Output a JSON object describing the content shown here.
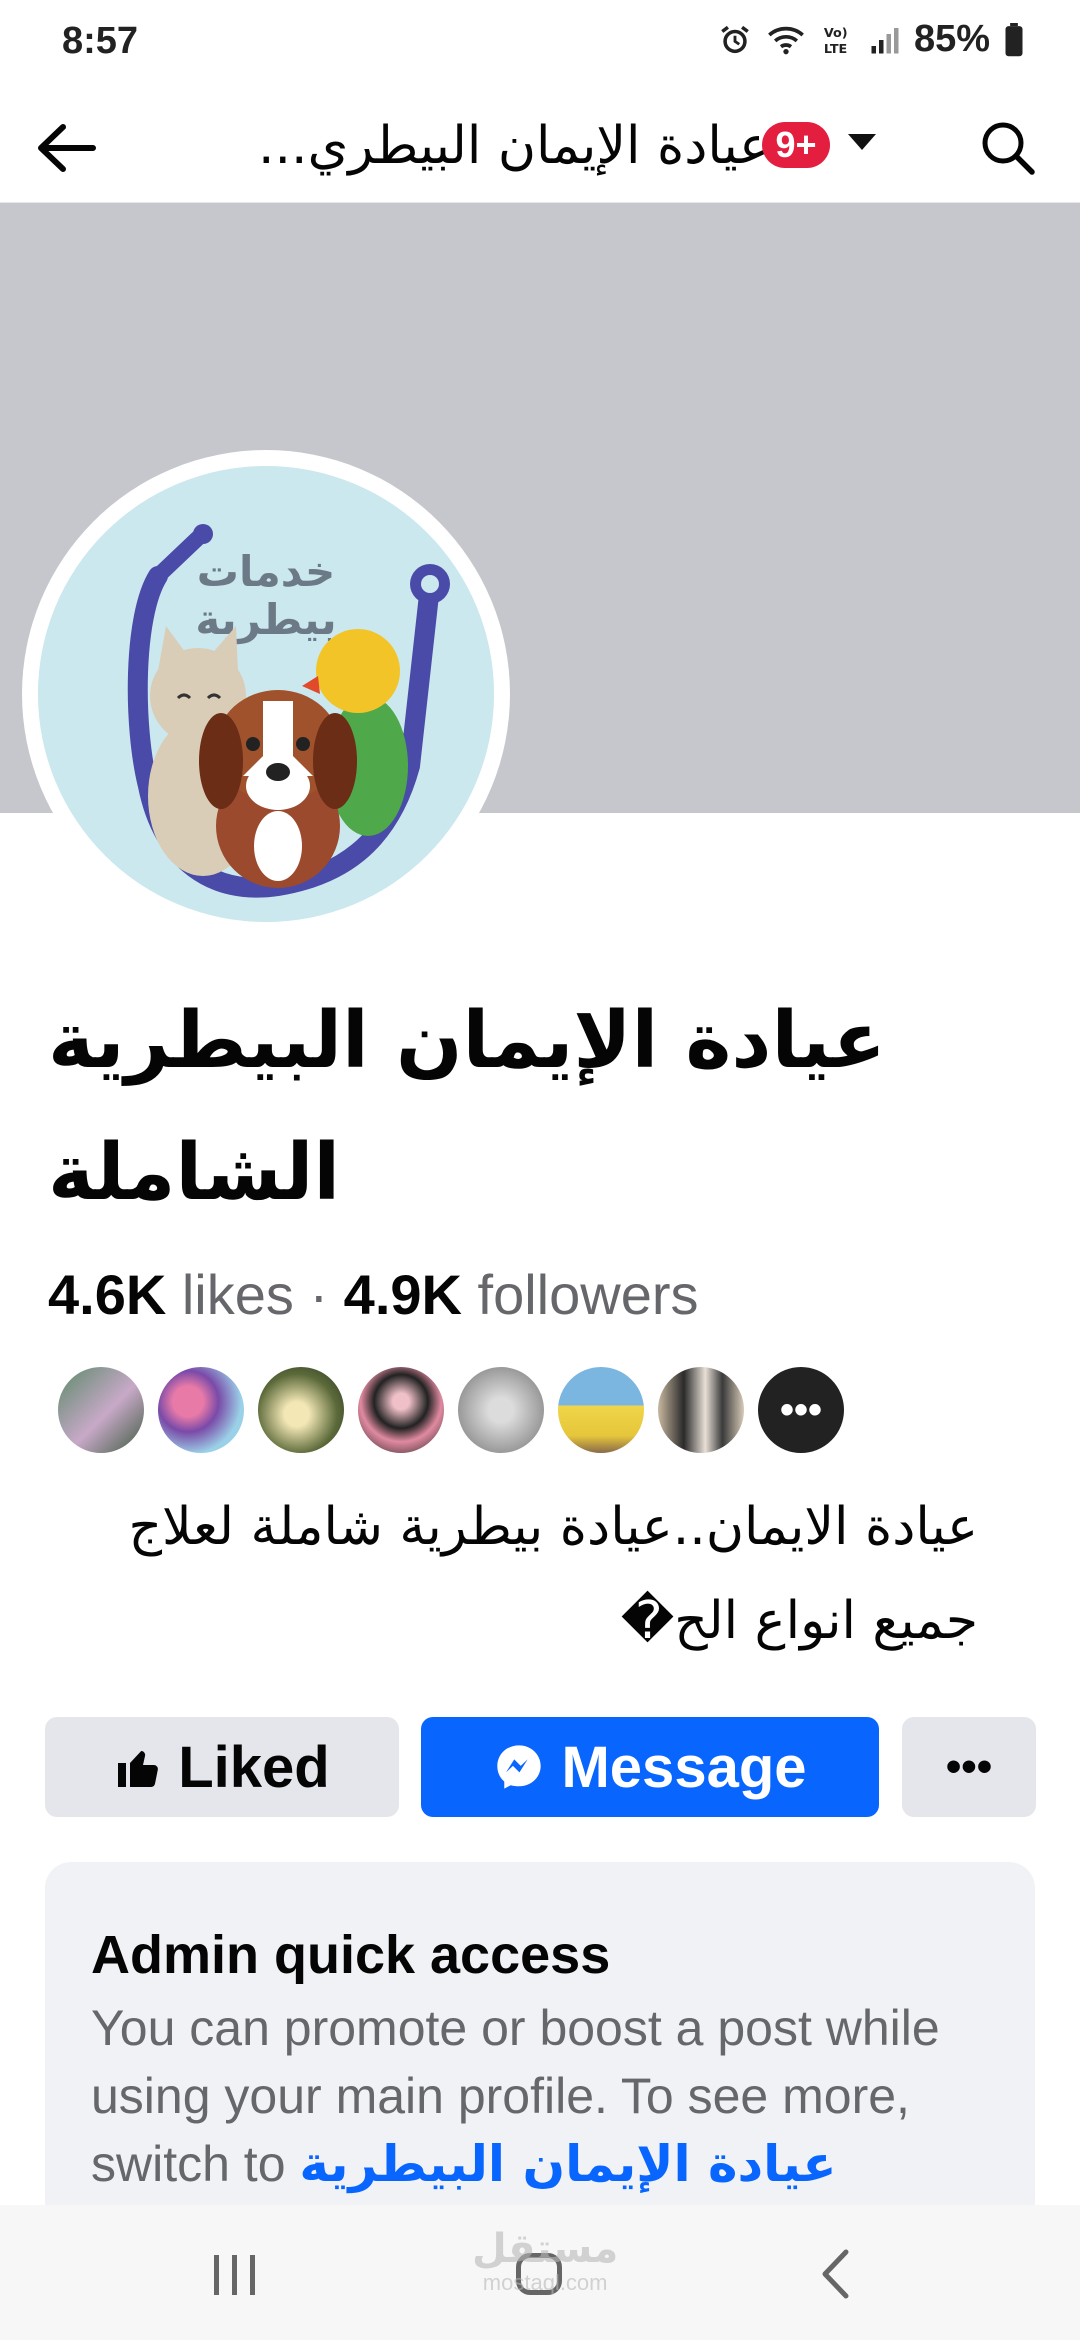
{
  "status_bar": {
    "time": "8:57",
    "battery": "85%"
  },
  "top_bar": {
    "title": "عيادة الإيمان البيطري...",
    "badge": "9+"
  },
  "avatar": {
    "logo_text_line1": "خدمات",
    "logo_text_line2": "بيطرية"
  },
  "page": {
    "name": "عيادة الإيمان البيطرية الشاملة",
    "likes_count": "4.6K",
    "likes_label": "likes",
    "separator": "·",
    "followers_count": "4.9K",
    "followers_label": "followers",
    "bio": "عيادة الايمان..عيادة بيطرية شاملة لعلاج جميع انواع الح�"
  },
  "actions": {
    "liked_label": "Liked",
    "message_label": "Message",
    "more_label": "•••"
  },
  "admin_card": {
    "title": "Admin quick access",
    "text": "You can promote or boost a post while using your main profile. To see more, switch to",
    "link": "عيادة الإيمان البيطرية"
  },
  "watermark": {
    "text": "مستقل",
    "sub": "mostaql.com"
  },
  "colors": {
    "accent": "#0866ff",
    "cover": "#c5c7cc",
    "badge": "#e41e3f"
  }
}
